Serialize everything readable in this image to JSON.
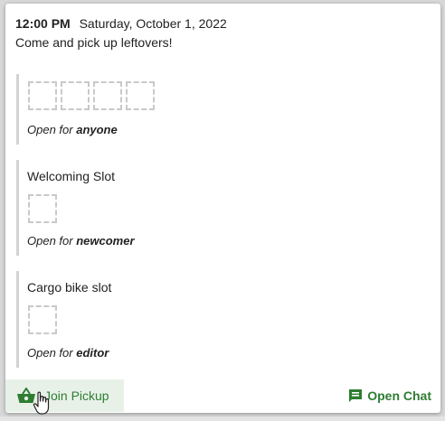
{
  "pickup": {
    "time": "12:00 PM",
    "date": "Saturday, October 1, 2022",
    "description": "Come and pick up leftovers!"
  },
  "slots": [
    {
      "title": "",
      "seat_count": 4,
      "open_for_prefix": "Open for",
      "role": "anyone"
    },
    {
      "title": "Welcoming Slot",
      "seat_count": 1,
      "open_for_prefix": "Open for",
      "role": "newcomer"
    },
    {
      "title": "Cargo bike slot",
      "seat_count": 1,
      "open_for_prefix": "Open for",
      "role": "editor"
    }
  ],
  "actions": {
    "join_label": "Join Pickup",
    "join_icon": "basket-icon",
    "chat_label": "Open Chat",
    "chat_icon": "chat-icon"
  },
  "colors": {
    "accent": "#2e7d32",
    "join_background": "#e8f1e8",
    "slot_border": "#d3d3d3"
  }
}
